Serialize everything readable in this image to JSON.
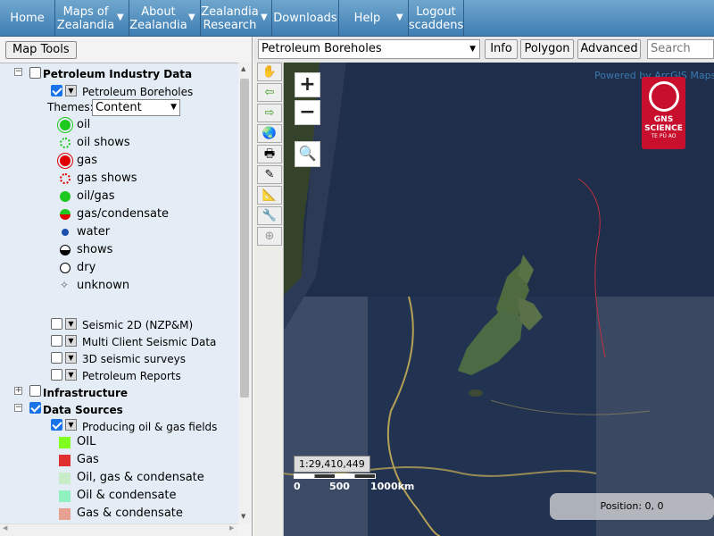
{
  "nav": {
    "home": "Home",
    "maps": "Maps of Zealandia",
    "about": "About Zealandia",
    "research": "Zealandia Research",
    "downloads": "Downloads",
    "help": "Help",
    "logout": "Logout scaddens"
  },
  "left": {
    "maptools": "Map Tools",
    "petroleum_industry": "Petroleum Industry Data",
    "petroleum_boreholes": "Petroleum Boreholes",
    "themes_label": "Themes:",
    "themes_value": "Content",
    "legend": [
      "oil",
      "oil shows",
      "gas",
      "gas shows",
      "oil/gas",
      "gas/condensate",
      "water",
      "shows",
      "dry",
      "unknown"
    ],
    "seismic2d": "Seismic 2D (NZP&M)",
    "multiclient": "Multi Client Seismic Data",
    "seismic3d": "3D seismic surveys",
    "reports": "Petroleum Reports",
    "infrastructure": "Infrastructure",
    "data_sources": "Data Sources",
    "producing": "Producing oil & gas fields",
    "fields": [
      "OIL",
      "Gas",
      "Oil, gas & condensate",
      "Oil & condensate",
      "Gas & condensate"
    ]
  },
  "mapbar": {
    "layer": "Petroleum Boreholes",
    "info": "Info",
    "polygon": "Polygon",
    "advanced": "Advanced",
    "search_placeholder": "Search layers"
  },
  "map": {
    "attribution": "Powered by ArcGIS Mapservice",
    "zoom_in": "+",
    "zoom_out": "−",
    "logo_text": "GNS SCIENCE",
    "logo_sub": "TE PŪ AO",
    "scale": "1:29,410,449",
    "scale_ticks": [
      "0",
      "500",
      "1000km"
    ],
    "position": "Position: 0, 0"
  },
  "colors": {
    "nav": "#4f8fc2",
    "oil": "#1ec81e",
    "gas": "#e00000",
    "field_oil": "#80ff20",
    "field_gas": "#e03030",
    "field_ogc": "#c8ecc8",
    "field_oc": "#90f0c0",
    "field_gc": "#e8a090"
  }
}
